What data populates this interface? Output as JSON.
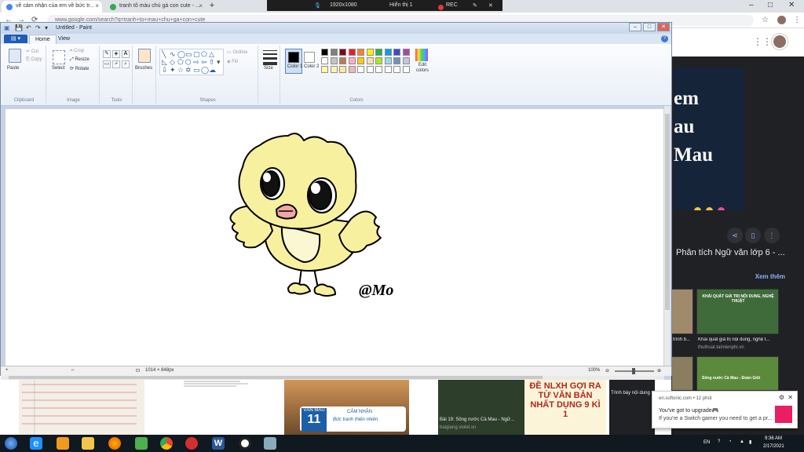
{
  "browser": {
    "tabs": [
      {
        "label": "về cảm nhận của em về bức tr..."
      },
      {
        "label": "tranh tô màu chú gà con cute - ..."
      }
    ],
    "url": "www.google.com/search?q=tranh+to+mau+chu+ga+con+cute",
    "recorder": {
      "resolution": "1920x1080",
      "display": "Hiển thị 1",
      "rec_label": "REC"
    }
  },
  "paint": {
    "title": "Untitled - Paint",
    "menu": {
      "file_label": "",
      "tabs": [
        "Home",
        "View"
      ]
    },
    "ribbon": {
      "clipboard": {
        "paste": "Paste",
        "cut": "Cut",
        "copy": "Copy",
        "label": "Clipboard"
      },
      "image": {
        "select": "Select",
        "crop": "Crop",
        "resize": "Resize",
        "rotate": "Rotate",
        "label": "Image"
      },
      "tools": {
        "label": "Tools"
      },
      "brushes": {
        "label": "Brushes"
      },
      "shapes": {
        "outline": "Outline",
        "fill": "Fill",
        "label": "Shapes"
      },
      "size": {
        "label": "Size"
      },
      "colors": {
        "color1": "Color 1",
        "color2": "Color 2",
        "edit": "Edit colors",
        "label": "Colors",
        "color1_value": "#000000",
        "color2_value": "#ffffff",
        "palette": [
          "#000000",
          "#7f7f7f",
          "#880015",
          "#ed1c24",
          "#ff7f27",
          "#fff200",
          "#22b14c",
          "#00a2e8",
          "#3f48cc",
          "#a349a4",
          "#ffffff",
          "#c3c3c3",
          "#b97a57",
          "#ffaec9",
          "#ffc90e",
          "#efe4b0",
          "#b5e61d",
          "#99d9ea",
          "#7092be",
          "#c8bfe7"
        ]
      }
    },
    "canvas": {
      "signature": "@Mo"
    },
    "status": {
      "dimensions": "1014 × 848px",
      "zoom": "100%"
    }
  },
  "right_panel": {
    "hero_lines": [
      "em",
      "au",
      "Mau"
    ],
    "result_title": "Phân tích Ngữ văn lớp 6 - ...",
    "see_more": "Xem thêm",
    "cards": [
      {
        "caption": "trình b...",
        "sub": ""
      },
      {
        "caption": "Khái quát giá trị nội dung, nghệ t...",
        "sub": "thuthuat.taimienphi.vn"
      },
      {
        "caption": "Sông nước Cà Mau - Đoàn Giỏi",
        "sub": ""
      }
    ],
    "card_overlay": "KHÁI QUÁT GIÁ TRỊ NỘI DUNG, NGHỆ THUẬT"
  },
  "bottom_thumbs": {
    "van_mau": "VĂN MẪU",
    "grade": "11",
    "cam_nhan": "CẢM NHẬN",
    "buc_tranh": "Bức tranh thiên nhiên",
    "thumb3_caption": "Bài 19: Sông nước Cà Mau - Ngữ...",
    "thumb3_sub": "baigiang.violet.vn",
    "thumb4_text": "ĐỀ NLXH GỢI RA TỪ VĂN BẢN NHẤT DỤNG 9 KÌ 1",
    "thumb5_caption": "Trình bày nội dung"
  },
  "notification": {
    "source": "en.softonic.com • 12 phút",
    "line1": "You've got to upgrade🎮",
    "line2": "If you're a Switch gamer you need to get a pr..."
  },
  "taskbar": {
    "lang": "EN",
    "time": "9:36 AM",
    "date": "2/17/2021"
  }
}
